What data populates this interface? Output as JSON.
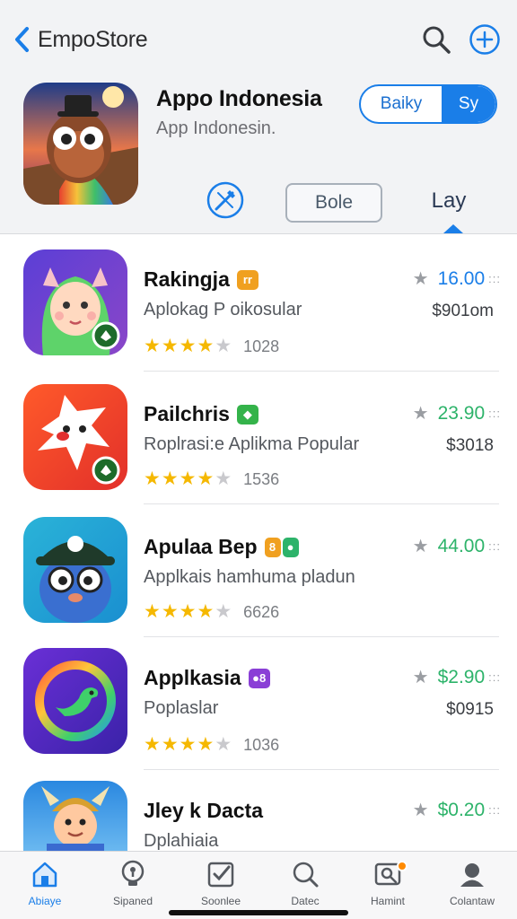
{
  "nav": {
    "store_name": "EmpoStore"
  },
  "hero": {
    "title": "Appo Indonesia",
    "subtitle": "App Indonesin.",
    "segment": {
      "option_a": "Baiky",
      "option_b": "Sy"
    },
    "secondary_button": "Bole",
    "tab_label": "Lay"
  },
  "apps": [
    {
      "name": "Rakingja",
      "badge": "rr",
      "badge_color": "#f0a020",
      "description": "Aplokag P oikosular",
      "stars": 4,
      "review_count": "1028",
      "price": "16.00",
      "price_color": "#1a7ee8",
      "sub_price": "$901om",
      "icon": "unicorn-girl-app-icon"
    },
    {
      "name": "Pailchris",
      "badge": "◆",
      "badge_color": "#34b34a",
      "description": "Roplrasi:e Aplikma Popular",
      "stars": 4,
      "review_count": "1536",
      "price": "23.90",
      "price_color": "#2db36a",
      "sub_price": "$3018",
      "icon": "white-ghost-app-icon"
    },
    {
      "name": "Apulaa Bep",
      "badge": "8",
      "badge_color": "#f0a020",
      "badge2": "●",
      "badge2_color": "#2db36a",
      "description": "Applkais hamhuma pladun",
      "stars": 4,
      "review_count": "6626",
      "price": "44.00",
      "price_color": "#2db36a",
      "sub_price": "",
      "icon": "cap-character-app-icon"
    },
    {
      "name": "Applkasia",
      "badge": "●8",
      "badge_color": "#8a3fd6",
      "description": "Poplaslar",
      "stars": 4,
      "review_count": "1036",
      "price": "$2.90",
      "price_color": "#2db36a",
      "sub_price": "$0915",
      "icon": "rainbow-bird-app-icon"
    },
    {
      "name": "Jley k Dacta",
      "badge": "",
      "badge_color": "",
      "description": "Dplahiaia",
      "stars": 0,
      "review_count": "",
      "price": "$0.20",
      "price_color": "#2db36a",
      "sub_price": "",
      "icon": "viking-character-app-icon"
    }
  ],
  "tabbar": [
    {
      "label": "Abiaye",
      "icon": "home-icon",
      "active": true
    },
    {
      "label": "Sipaned",
      "icon": "lightbulb-icon",
      "active": false
    },
    {
      "label": "Soonlee",
      "icon": "checkbox-icon",
      "active": false
    },
    {
      "label": "Datec",
      "icon": "search-icon",
      "active": false
    },
    {
      "label": "Hamint",
      "icon": "profile-card-icon",
      "active": false
    },
    {
      "label": "Colantaw",
      "icon": "person-icon",
      "active": false
    }
  ],
  "colors": {
    "accent": "#1a7ee8",
    "star": "#f5b800",
    "green_price": "#2db36a"
  }
}
